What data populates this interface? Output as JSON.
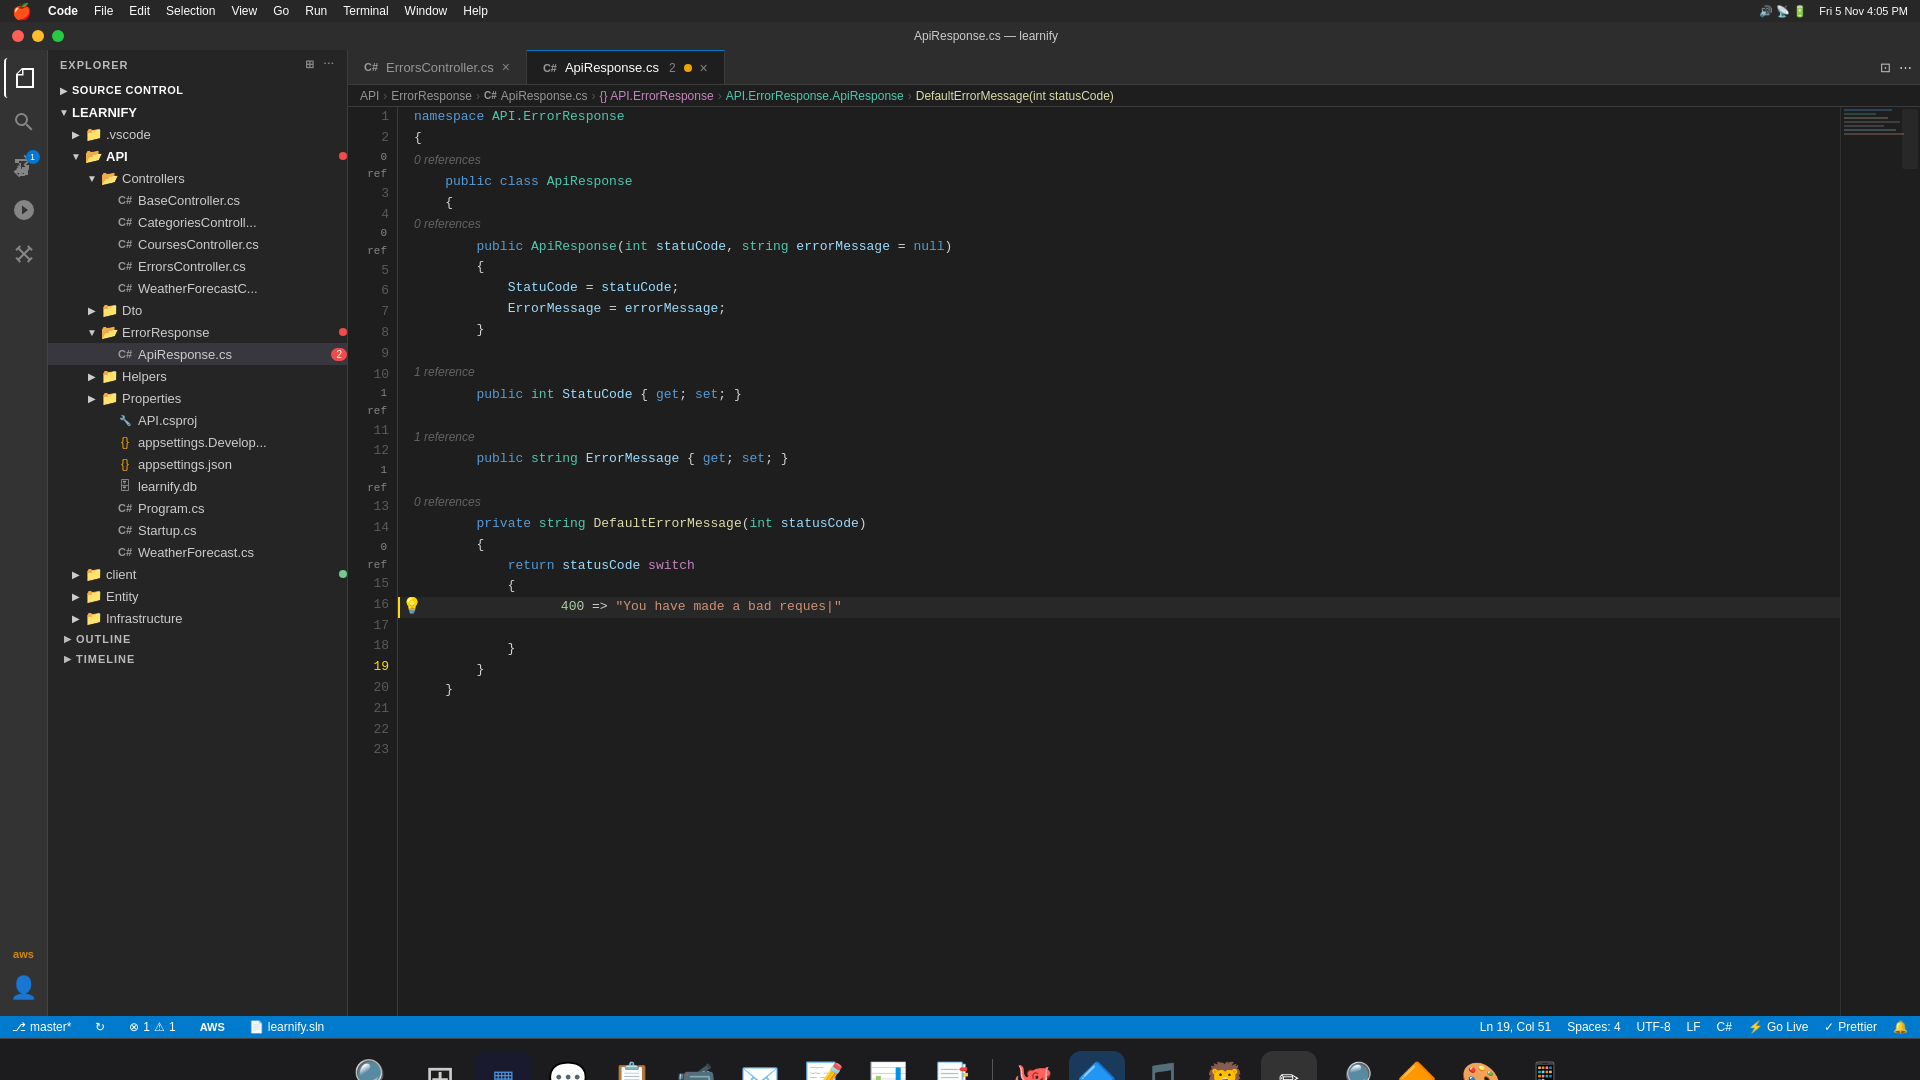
{
  "system": {
    "apple_menu": "Apple",
    "app_name": "Code",
    "menus": [
      "File",
      "Edit",
      "Selection",
      "View",
      "Go",
      "Run",
      "Terminal",
      "Window",
      "Help"
    ],
    "time": "Fri 5 Nov  4:05 PM",
    "title": "ApiResponse.cs — learnify"
  },
  "tabs": [
    {
      "id": "errors",
      "label": "ErrorsController.cs",
      "type": "cs",
      "active": false,
      "modified": false
    },
    {
      "id": "apiresponse",
      "label": "ApiResponse.cs",
      "type": "cs",
      "active": true,
      "modified": true,
      "count": 2
    }
  ],
  "breadcrumb": {
    "items": [
      "API",
      "ErrorResponse",
      "ApiResponse.cs",
      "{} API.ErrorResponse",
      "API.ErrorResponse.ApiResponse",
      "DefaultErrorMessage(int statusCode)"
    ]
  },
  "sidebar": {
    "explorer_title": "EXPLORER",
    "source_control": "SOURCE CONTROL",
    "root": "LEARNIFY",
    "items": [
      {
        "label": ".vscode",
        "type": "folder",
        "indent": 1,
        "collapsed": true
      },
      {
        "label": "API",
        "type": "folder-open",
        "indent": 1,
        "collapsed": false,
        "badge": "red"
      },
      {
        "label": "Controllers",
        "type": "folder-open",
        "indent": 2,
        "collapsed": false
      },
      {
        "label": "BaseController.cs",
        "type": "cs",
        "indent": 3
      },
      {
        "label": "CategoriesControll...",
        "type": "cs",
        "indent": 3
      },
      {
        "label": "CoursesController.cs",
        "type": "cs",
        "indent": 3
      },
      {
        "label": "ErrorsController.cs",
        "type": "cs",
        "indent": 3
      },
      {
        "label": "WeatherForecastC...",
        "type": "cs",
        "indent": 3
      },
      {
        "label": "Dto",
        "type": "folder",
        "indent": 2,
        "collapsed": true
      },
      {
        "label": "ErrorResponse",
        "type": "folder-open",
        "indent": 2,
        "collapsed": false,
        "badge": "red"
      },
      {
        "label": "ApiResponse.cs",
        "type": "cs",
        "indent": 3,
        "active": true,
        "count": 2
      },
      {
        "label": "Helpers",
        "type": "folder",
        "indent": 2,
        "collapsed": true
      },
      {
        "label": "Properties",
        "type": "folder",
        "indent": 2,
        "collapsed": true
      },
      {
        "label": "API.csproj",
        "type": "csproj",
        "indent": 2
      },
      {
        "label": "appsettings.Develop...",
        "type": "json",
        "indent": 2
      },
      {
        "label": "appsettings.json",
        "type": "json",
        "indent": 2
      },
      {
        "label": "learnify.db",
        "type": "db",
        "indent": 2
      },
      {
        "label": "Program.cs",
        "type": "cs",
        "indent": 2
      },
      {
        "label": "Startup.cs",
        "type": "cs",
        "indent": 2
      },
      {
        "label": "WeatherForecast.cs",
        "type": "cs",
        "indent": 2
      },
      {
        "label": "client",
        "type": "folder",
        "indent": 1,
        "collapsed": true,
        "badge": "green"
      },
      {
        "label": "Entity",
        "type": "folder",
        "indent": 1,
        "collapsed": true
      },
      {
        "label": "Infrastructure",
        "type": "folder",
        "indent": 1,
        "collapsed": true
      }
    ],
    "outline": "OUTLINE",
    "timeline": "TIMELINE"
  },
  "code": {
    "lines": [
      {
        "num": 1,
        "content": "namespace API.ErrorResponse",
        "type": "normal"
      },
      {
        "num": 2,
        "content": "{",
        "type": "normal"
      },
      {
        "num": 3,
        "content": "    public class ApiResponse",
        "type": "normal",
        "hint": "0 references"
      },
      {
        "num": 4,
        "content": "    {",
        "type": "normal"
      },
      {
        "num": 5,
        "content": "        public ApiResponse(int statuCode, string errorMessage = null)",
        "type": "normal",
        "hint": "0 references"
      },
      {
        "num": 6,
        "content": "        {",
        "type": "normal"
      },
      {
        "num": 7,
        "content": "            StatuCode = statuCode;",
        "type": "normal"
      },
      {
        "num": 8,
        "content": "            ErrorMessage = errorMessage;",
        "type": "normal"
      },
      {
        "num": 9,
        "content": "        }",
        "type": "normal"
      },
      {
        "num": 10,
        "content": "",
        "type": "normal"
      },
      {
        "num": 11,
        "content": "        public int StatuCode { get; set; }",
        "type": "normal",
        "hint": "1 reference"
      },
      {
        "num": 12,
        "content": "",
        "type": "normal"
      },
      {
        "num": 13,
        "content": "        public string ErrorMessage { get; set; }",
        "type": "normal",
        "hint": "1 reference"
      },
      {
        "num": 14,
        "content": "",
        "type": "normal"
      },
      {
        "num": 15,
        "content": "        private string DefaultErrorMessage(int statusCode)",
        "type": "normal",
        "hint": "0 references"
      },
      {
        "num": 16,
        "content": "        {",
        "type": "normal"
      },
      {
        "num": 17,
        "content": "            return statusCode switch",
        "type": "normal"
      },
      {
        "num": 18,
        "content": "            {",
        "type": "normal"
      },
      {
        "num": 19,
        "content": "                400 => \"You have made a bad reques|\"",
        "type": "active"
      },
      {
        "num": 20,
        "content": "",
        "type": "normal"
      },
      {
        "num": 21,
        "content": "            }",
        "type": "normal"
      },
      {
        "num": 22,
        "content": "        }",
        "type": "normal"
      },
      {
        "num": 23,
        "content": "    }",
        "type": "normal"
      }
    ]
  },
  "status": {
    "branch": "master*",
    "errors": "1",
    "warnings": "1",
    "position": "Ln 19, Col 51",
    "spaces": "Spaces: 4",
    "encoding": "UTF-8",
    "line_ending": "LF",
    "language": "C#",
    "live": "Go Live",
    "prettier": "Prettier"
  },
  "dock": {
    "items": [
      {
        "name": "finder",
        "icon": "🔍",
        "label": "Finder"
      },
      {
        "name": "launchpad",
        "icon": "🚀",
        "label": "Launchpad"
      },
      {
        "name": "dashboard",
        "icon": "⬛",
        "label": "Dashboard"
      },
      {
        "name": "discord",
        "icon": "💬",
        "label": "Discord"
      },
      {
        "name": "clipy",
        "icon": "📋",
        "label": "Clipy"
      },
      {
        "name": "facetime",
        "icon": "📹",
        "label": "FaceTime"
      },
      {
        "name": "apple-mail",
        "icon": "✉️",
        "label": "Mail"
      },
      {
        "name": "notes",
        "icon": "🗒️",
        "label": "Notes"
      },
      {
        "name": "sheets",
        "icon": "📊",
        "label": "Sheets"
      },
      {
        "name": "presentations",
        "icon": "📑",
        "label": "Keynote"
      },
      {
        "name": "github",
        "icon": "🐙",
        "label": "GitHub"
      },
      {
        "name": "vscode",
        "icon": "🔷",
        "label": "VSCode",
        "active": true
      },
      {
        "name": "spotify",
        "icon": "🎵",
        "label": "Spotify"
      },
      {
        "name": "brave",
        "icon": "🦁",
        "label": "Brave"
      },
      {
        "name": "cursor",
        "icon": "⬜",
        "label": "Cursor"
      },
      {
        "name": "magnifier",
        "icon": "🔎",
        "label": "Magnifier"
      },
      {
        "name": "vlc",
        "icon": "🔶",
        "label": "VLC"
      },
      {
        "name": "extra1",
        "icon": "🎨",
        "label": "App"
      },
      {
        "name": "extra2",
        "icon": "📱",
        "label": "App"
      }
    ]
  }
}
